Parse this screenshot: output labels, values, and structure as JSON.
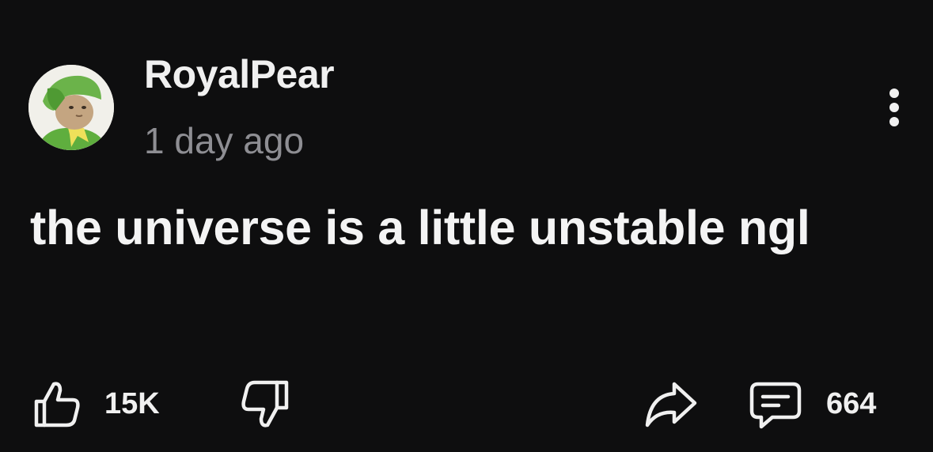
{
  "post": {
    "author": "RoyalPear",
    "timestamp": "1 day ago",
    "body": "the universe is a little unstable ngl"
  },
  "actions": {
    "upvote_count": "15K",
    "comment_count": "664"
  },
  "icons": {
    "avatar": "green-hat-character-avatar",
    "more": "vertical-ellipsis-icon",
    "upvote": "thumbs-up-icon",
    "downvote": "thumbs-down-icon",
    "share": "share-arrow-icon",
    "comments": "comment-bubble-icon"
  },
  "colors": {
    "background": "#0e0e0f",
    "text": "#f2f2f2",
    "muted": "#8e8e93",
    "avatar_green": "#6bb34a"
  }
}
